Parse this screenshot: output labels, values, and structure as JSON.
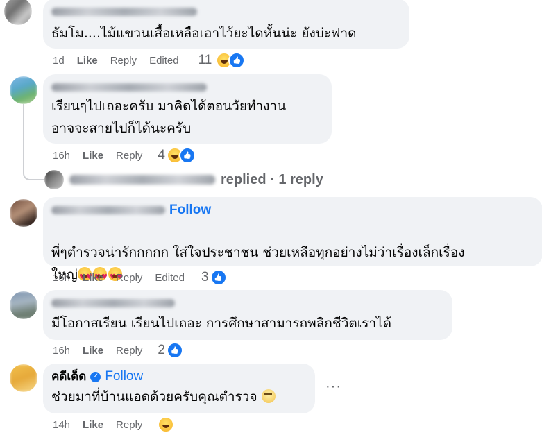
{
  "comments": [
    {
      "text": "ธัมโม....ไม้แขวนเสื้อเหลือเอาไว้ยะไดหั้นน่ะ ยังบ่ะฟาด",
      "time": "1d",
      "like": "Like",
      "reply": "Reply",
      "edited": "Edited",
      "reaction_count": "11"
    },
    {
      "text": "เรียนๆไปเถอะครับ มาคิดได้ตอนวัยทำงาน\nอาจจะสายไปก็ได้นะครับ",
      "time": "16h",
      "like": "Like",
      "reply": "Reply",
      "reaction_count": "4",
      "replies_label": "replied · 1 reply"
    },
    {
      "follow": "Follow",
      "text": "พี่ๆตำรวจน่ารักกกกก ใส่ใจประชาชน ช่วยเหลือทุกอย่างไม่ว่าเรื่องเล็กเรื่อง\nใหญ่",
      "time": "16h",
      "like": "Like",
      "reply": "Reply",
      "edited": "Edited",
      "reaction_count": "3"
    },
    {
      "text": "มีโอกาสเรียน เรียนไปเถอะ การศึกษาสามารถพลิกชีวิตเราได้",
      "time": "16h",
      "like": "Like",
      "reply": "Reply",
      "reaction_count": "2"
    },
    {
      "name": "คดีเด็ด",
      "follow": "Follow",
      "text": "ช่วยมาที่บ้านแอดด้วยครับคุณตำรวจ",
      "time": "14h",
      "like": "Like",
      "reply": "Reply",
      "more": "···"
    }
  ],
  "colors": {
    "bubble": "#f0f2f5",
    "link": "#1877f2",
    "meta": "#65676b"
  },
  "icons": [
    "haha-reaction-icon",
    "like-reaction-icon",
    "heart-eyes-emoji",
    "verified-badge-icon",
    "more-options-icon"
  ]
}
